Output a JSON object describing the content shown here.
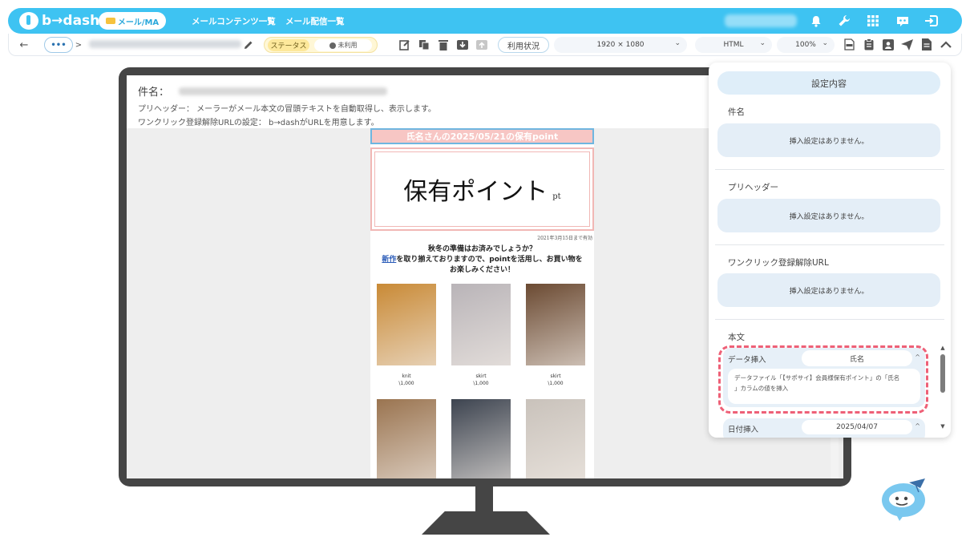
{
  "brand": {
    "name": "b→dash",
    "accent": "#3ec3f2"
  },
  "header": {
    "mode": "メール/MA",
    "nav": [
      "メールコンテンツ一覧",
      "メール配信一覧"
    ],
    "icons": [
      "bell-icon",
      "wrench-icon",
      "grid-icon",
      "chat-robot-icon",
      "logout-icon"
    ]
  },
  "toolbar": {
    "more": "•••",
    "breadcrumb_sep": ">",
    "status_label": "ステータス",
    "status_value": "未利用",
    "usage": "利用状況",
    "resolution": "1920 × 1080",
    "format": "HTML",
    "zoom": "100%"
  },
  "email_info": {
    "subject_label": "件名：",
    "preheader_line": "プリヘッダー： メーラーがメール本文の冒頭テキストを自動取得し、表示します。",
    "unsubscribe_line": "ワンクリック登録解除URLの設定： b→dashがURLを用意します。"
  },
  "mail": {
    "header": "氏名さんの2025/05/21の保有point",
    "points_title": "保有ポイント",
    "points_unit": "pt",
    "expiry": "2021年3月15日まで有効",
    "copy_line1": "秋冬の準備はお済みでしょうか？",
    "copy_link": "新作",
    "copy_line2_rest": "を取り揃えておりますので、pointを活用し、お買い物を",
    "copy_line3": "お楽しみください！",
    "products": [
      {
        "name": "knit",
        "price": "\\1,000",
        "color": "#c98a36"
      },
      {
        "name": "skirt",
        "price": "\\1,000",
        "color": "#b9b4b8"
      },
      {
        "name": "skirt",
        "price": "\\1,000",
        "color": "#6b4a32"
      },
      {
        "name": "",
        "price": "",
        "color": "#9a7450"
      },
      {
        "name": "",
        "price": "",
        "color": "#3d4450"
      },
      {
        "name": "",
        "price": "",
        "color": "#c9c2bb"
      }
    ]
  },
  "panel": {
    "title": "設定内容",
    "sections": [
      {
        "label": "件名",
        "value": "挿入設定はありません。"
      },
      {
        "label": "プリヘッダー",
        "value": "挿入設定はありません。"
      },
      {
        "label": "ワンクリック登録解除URL",
        "value": "挿入設定はありません。"
      }
    ],
    "body_label": "本文",
    "data_insert": {
      "label": "データ挿入",
      "value": "氏名",
      "description_line1": "データファイル「【サポサイ】会員様保有ポイント」の「氏名",
      "description_line2": "」カラムの値を挿入"
    },
    "date_insert": {
      "label": "日付挿入",
      "value": "2025/04/07"
    }
  }
}
